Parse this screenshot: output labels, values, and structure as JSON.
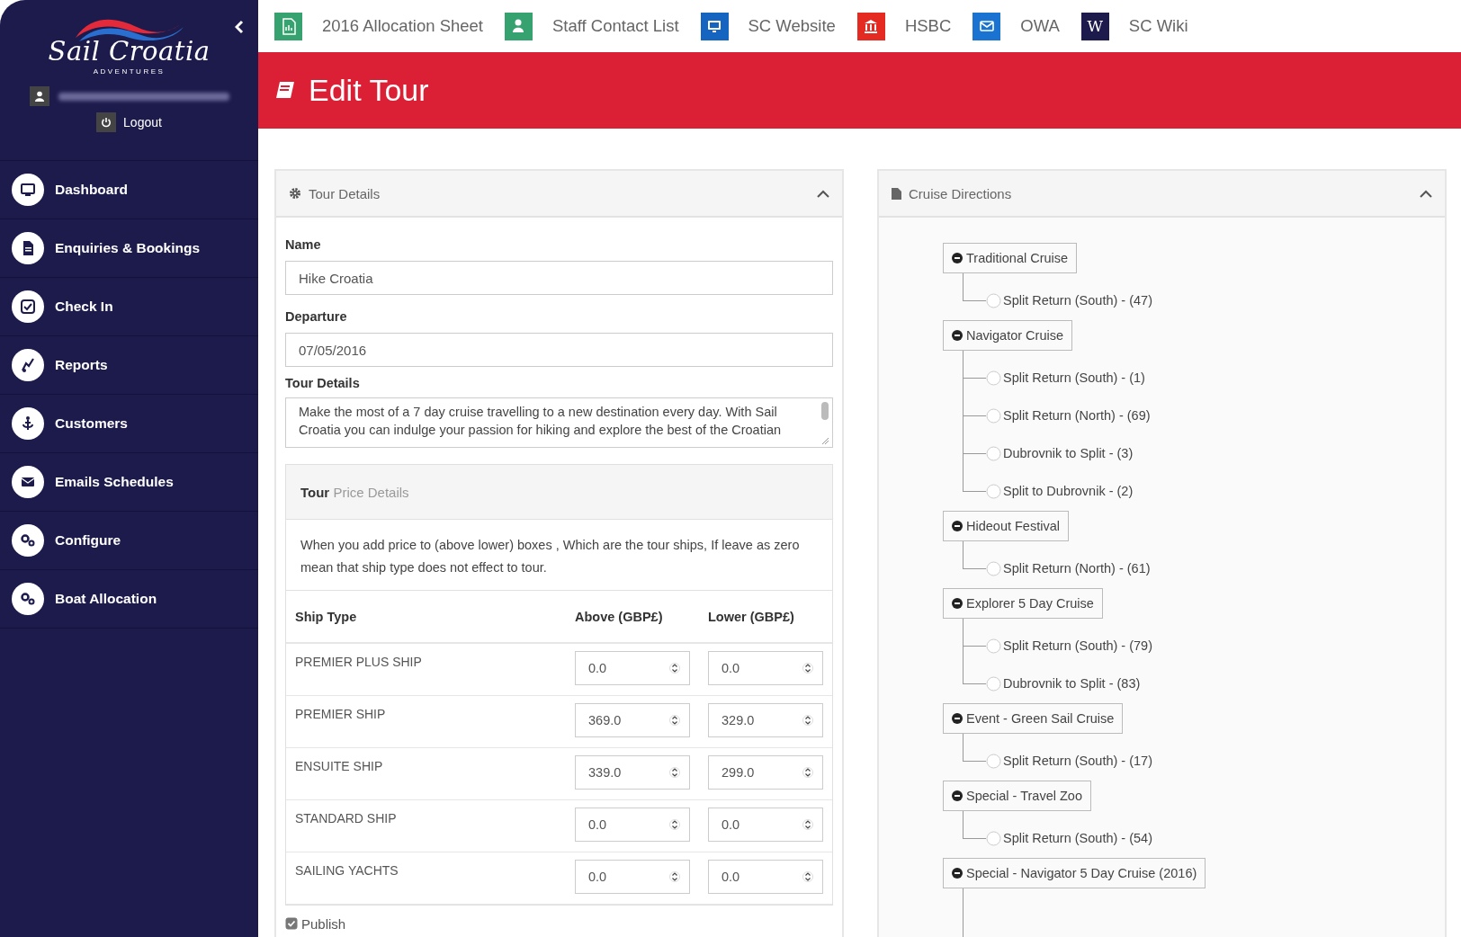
{
  "sidebar": {
    "brand": "Sail Croatia",
    "tagline": "ADVENTURES",
    "logout": "Logout",
    "items": [
      {
        "label": "Dashboard",
        "selected": false
      },
      {
        "label": "Enquiries & Bookings",
        "selected": false
      },
      {
        "label": "Check In",
        "selected": false
      },
      {
        "label": "Reports",
        "selected": false
      },
      {
        "label": "Customers",
        "selected": false
      },
      {
        "label": "Emails Schedules",
        "selected": false
      },
      {
        "label": "Configure",
        "selected": false
      },
      {
        "label": "Boat Allocation",
        "selected": false
      }
    ]
  },
  "shortcuts": [
    {
      "label": "2016 Allocation Sheet",
      "color": "#35a26f"
    },
    {
      "label": "Staff Contact List",
      "color": "#35a26f"
    },
    {
      "label": "SC Website",
      "color": "#1565c0"
    },
    {
      "label": "HSBC",
      "color": "#e52b21"
    },
    {
      "label": "OWA",
      "color": "#1a73d0"
    },
    {
      "label": "SC Wiki",
      "color": "#1d1b4c",
      "icon_text": "W"
    }
  ],
  "page_title": "Edit Tour",
  "tour_panel": {
    "title": "Tour Details",
    "fields": [
      {
        "label": "Name",
        "value": "Hike Croatia"
      },
      {
        "label": "Departure",
        "value": "07/05/2016"
      }
    ],
    "details_label": "Tour Details",
    "details_text": "Make the most of a 7 day cruise travelling to a new destination every day. With Sail Croatia you can indulge your passion for hiking and explore the best of the Croatian",
    "price": {
      "title": "**Tour** Price Details",
      "note": "When you add price to (above lower) boxes , Which are the tour ships, If leave as zero mean that ship type does not effect to tour.",
      "columns": [
        "Ship Type",
        "Above (GBP£)",
        "Lower (GBP£)"
      ],
      "rows": [
        {
          "ship": "PREMIER PLUS SHIP",
          "above": "0.0",
          "lower": "0.0"
        },
        {
          "ship": "PREMIER SHIP",
          "above": "369.0",
          "lower": "329.0"
        },
        {
          "ship": "ENSUITE SHIP",
          "above": "339.0",
          "lower": "299.0"
        },
        {
          "ship": "STANDARD SHIP",
          "above": "0.0",
          "lower": "0.0"
        },
        {
          "ship": "SAILING YACHTS",
          "above": "0.0",
          "lower": "0.0"
        }
      ]
    },
    "publish": {
      "label": "Publish",
      "checked": true
    }
  },
  "directions": {
    "title": "Cruise Directions",
    "tree": [
      {
        "label": "Traditional Cruise",
        "expanded": true,
        "children": [
          {
            "label": "Split Return (South) - (47)"
          }
        ]
      },
      {
        "label": "Navigator Cruise",
        "expanded": true,
        "children": [
          {
            "label": "Split Return (South) - (1)"
          },
          {
            "label": "Split Return (North) - (69)"
          },
          {
            "label": "Dubrovnik to Split - (3)"
          },
          {
            "label": "Split to Dubrovnik - (2)"
          }
        ]
      },
      {
        "label": "Hideout Festival",
        "expanded": true,
        "children": [
          {
            "label": "Split Return (North) - (61)"
          }
        ]
      },
      {
        "label": "Explorer 5 Day Cruise",
        "expanded": true,
        "children": [
          {
            "label": "Split Return (South) - (79)"
          },
          {
            "label": "Dubrovnik to Split - (83)"
          }
        ]
      },
      {
        "label": "Event - Green Sail Cruise",
        "expanded": true,
        "children": [
          {
            "label": "Split Return (South) - (17)"
          }
        ]
      },
      {
        "label": "Special - Travel Zoo",
        "expanded": true,
        "children": [
          {
            "label": "Split Return (South) - (54)"
          }
        ]
      },
      {
        "label": "Special - Navigator 5 Day Cruise (2016)",
        "expanded": true
      }
    ]
  }
}
